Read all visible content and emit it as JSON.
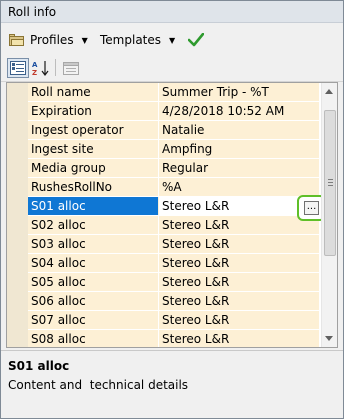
{
  "window": {
    "title": "Roll info"
  },
  "toolbar": {
    "profiles_label": "Profiles",
    "templates_label": "Templates",
    "icons": [
      "folder-icon",
      "caret-down-icon",
      "checkmark-icon",
      "categorized-view-icon",
      "sort-alpha-icon",
      "property-pages-icon"
    ],
    "accent_color": "#2e9a2e"
  },
  "grid": {
    "rows": [
      {
        "name": "Roll name",
        "value": "Summer Trip - %T"
      },
      {
        "name": "Expiration",
        "value": "4/28/2018 10:52 AM"
      },
      {
        "name": "Ingest operator",
        "value": "Natalie"
      },
      {
        "name": "Ingest site",
        "value": "Ampfing"
      },
      {
        "name": "Media group",
        "value": "Regular"
      },
      {
        "name": "RushesRollNo",
        "value": "%A"
      },
      {
        "name": "S01 alloc",
        "value": "Stereo L&R",
        "selected": true
      },
      {
        "name": "S02 alloc",
        "value": "Stereo L&R"
      },
      {
        "name": "S03 alloc",
        "value": "Stereo L&R"
      },
      {
        "name": "S04 alloc",
        "value": "Stereo L&R"
      },
      {
        "name": "S05 alloc",
        "value": "Stereo L&R"
      },
      {
        "name": "S06 alloc",
        "value": "Stereo L&R"
      },
      {
        "name": "S07 alloc",
        "value": "Stereo L&R"
      },
      {
        "name": "S08 alloc",
        "value": "Stereo L&R"
      }
    ],
    "ellipsis_label": "...",
    "selection_color": "#0f77d4",
    "row_color": "#fdf0d5",
    "highlight_color": "#5fbf28"
  },
  "description": {
    "title": "S01 alloc",
    "text": "Content and  technical details"
  }
}
